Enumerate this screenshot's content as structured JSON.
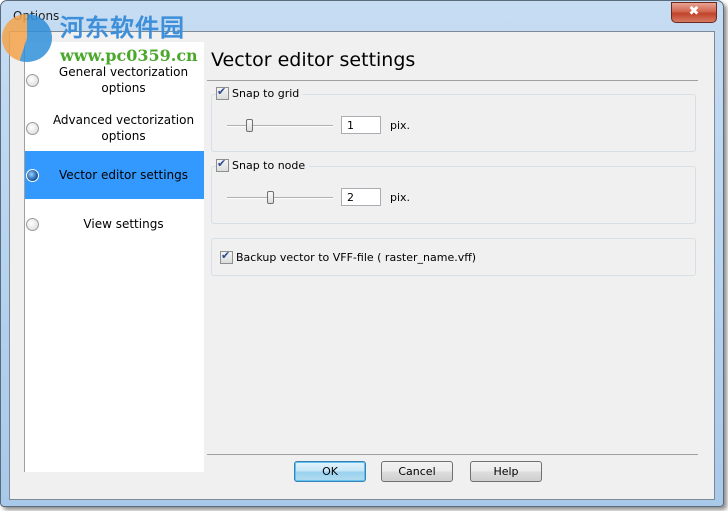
{
  "window": {
    "title": "Options",
    "close_label": "x"
  },
  "watermark": {
    "site_name": "河东软件园",
    "url": "www.pc0359.cn"
  },
  "sidebar": {
    "items": [
      {
        "label": "General vectorization options",
        "selected": false
      },
      {
        "label": "Advanced vectorization options",
        "selected": false
      },
      {
        "label": "Vector editor settings",
        "selected": true
      },
      {
        "label": "View settings",
        "selected": false
      }
    ]
  },
  "main": {
    "title": "Vector editor settings",
    "snap_grid": {
      "label": "Snap to grid",
      "checked": true,
      "value": "1",
      "unit": "pix.",
      "slider_fraction": 0.2
    },
    "snap_node": {
      "label": "Snap to node",
      "checked": true,
      "value": "2",
      "unit": "pix.",
      "slider_fraction": 0.4
    },
    "backup": {
      "label": "Backup vector to VFF-file ( raster_name.vff)",
      "checked": true
    }
  },
  "buttons": {
    "ok": "OK",
    "cancel": "Cancel",
    "help": "Help"
  },
  "colors": {
    "selection": "#3399ff",
    "dialog_bg": "#f0f0f0",
    "close_red": "#c0432a"
  }
}
